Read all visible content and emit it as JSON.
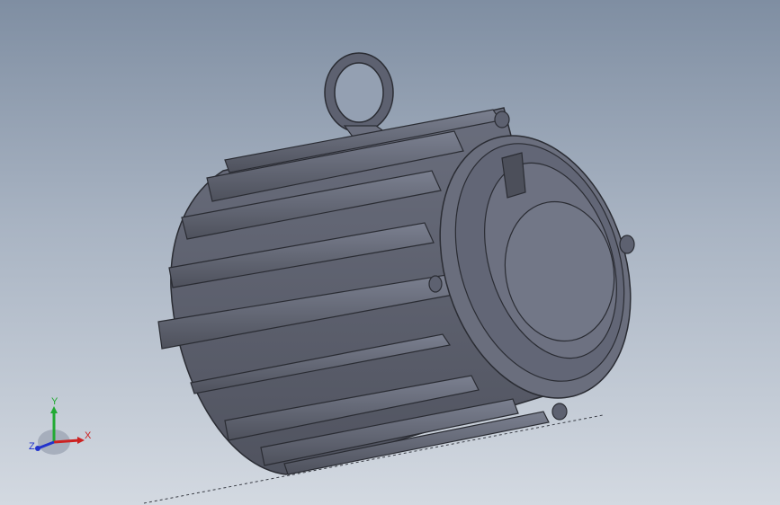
{
  "viewport": {
    "background_top": "#7f8ea2",
    "background_bottom": "#d3d9e1"
  },
  "model": {
    "description_icon": "electric-motor-model",
    "body_color": "#5d6170",
    "edge_color": "#2a2c33",
    "face_color": "#727787"
  },
  "triad": {
    "x_label": "X",
    "y_label": "Y",
    "z_label": "Z",
    "x_color": "#cc2222",
    "y_color": "#22aa33",
    "z_color": "#2233cc"
  }
}
